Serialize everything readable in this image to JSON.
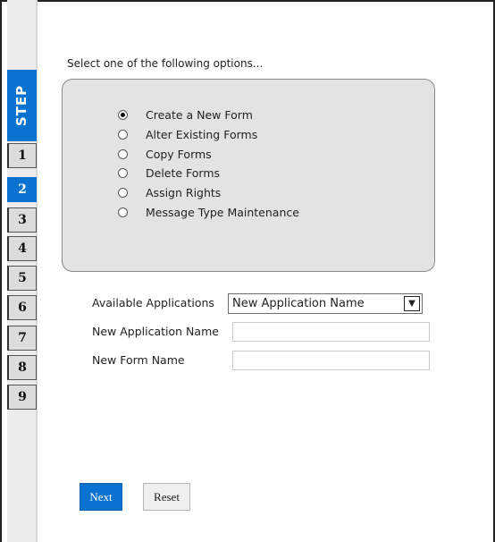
{
  "wizard": {
    "step_header": "STEP",
    "steps": [
      "1",
      "2",
      "3",
      "4",
      "5",
      "6",
      "7",
      "8",
      "9"
    ],
    "active_step": "2"
  },
  "instruction": "Select one of the following options...",
  "options": [
    {
      "label": "Create a New Form",
      "selected": true
    },
    {
      "label": "Alter Existing Forms",
      "selected": false
    },
    {
      "label": "Copy Forms",
      "selected": false
    },
    {
      "label": "Delete Forms",
      "selected": false
    },
    {
      "label": "Assign Rights",
      "selected": false
    },
    {
      "label": "Message Type Maintenance",
      "selected": false
    }
  ],
  "form": {
    "available_applications_label": "Available Applications",
    "available_applications_value": "New Application Name",
    "new_application_name_label": "New Application Name",
    "new_application_name_value": "",
    "new_form_name_label": "New Form Name",
    "new_form_name_value": ""
  },
  "buttons": {
    "next_label": "Next",
    "reset_label": "Reset"
  },
  "colors": {
    "accent": "#0a72cf",
    "panel": "#e3e3e3"
  }
}
